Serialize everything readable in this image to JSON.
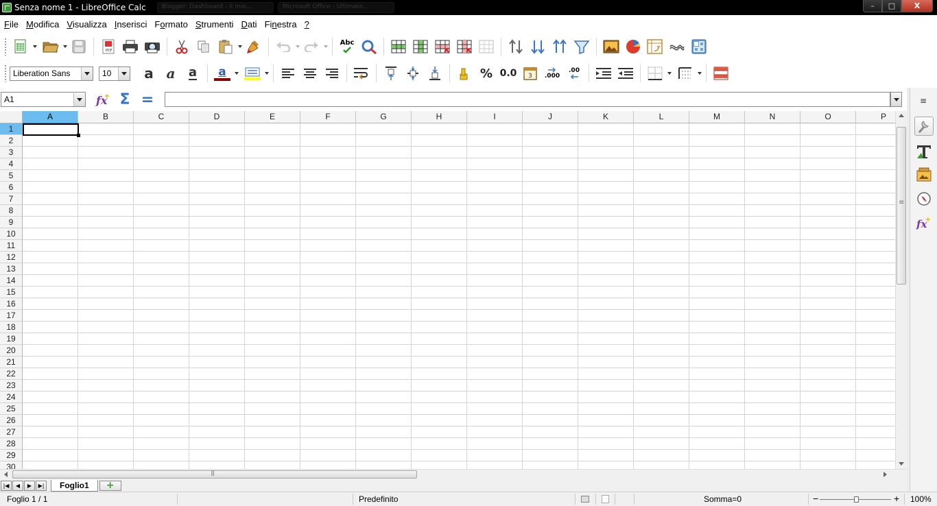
{
  "window": {
    "title": "Senza nome 1 - LibreOffice Calc",
    "background_tabs": [
      "Blogger: Dashboard - Il mio...",
      "Microsoft Office - Ultimate..."
    ],
    "controls": {
      "minimize": "–",
      "maximize": "□",
      "close": "X"
    }
  },
  "menubar": {
    "items": [
      {
        "pre": "",
        "u": "F",
        "post": "ile"
      },
      {
        "pre": "",
        "u": "M",
        "post": "odifica"
      },
      {
        "pre": "",
        "u": "V",
        "post": "isualizza"
      },
      {
        "pre": "",
        "u": "I",
        "post": "nserisci"
      },
      {
        "pre": "F",
        "u": "o",
        "post": "rmato"
      },
      {
        "pre": "",
        "u": "S",
        "post": "trumenti"
      },
      {
        "pre": "",
        "u": "D",
        "post": "ati"
      },
      {
        "pre": "Fi",
        "u": "n",
        "post": "estra"
      },
      {
        "pre": "",
        "u": "?",
        "post": ""
      }
    ]
  },
  "standard_toolbar": {
    "icons": [
      "new-document-icon",
      "open-folder-icon",
      "save-icon",
      "export-pdf-icon",
      "print-icon",
      "print-preview-icon",
      "cut-icon",
      "copy-icon",
      "paste-icon",
      "clone-formatting-icon",
      "undo-icon",
      "redo-icon",
      "spellcheck-icon",
      "autospellcheck-icon",
      "insert-rows-icon",
      "insert-columns-icon",
      "delete-rows-icon",
      "delete-columns-icon",
      "merge-cells-icon",
      "sort-icon",
      "sort-ascending-icon",
      "sort-descending-icon",
      "autofilter-icon",
      "insert-image-icon",
      "insert-chart-icon",
      "pivot-table-icon",
      "special-character-icon",
      "show-draw-functions-icon"
    ],
    "spellcheck_label": "Abc"
  },
  "formatting_toolbar": {
    "font_name": "Liberation Sans",
    "font_size": "10",
    "font_color": "#8b0000",
    "highlight_color": "#ffff00",
    "bold_glyph": "a",
    "italic_glyph": "a",
    "underline_glyph": "a",
    "font_color_glyph": "a",
    "percent_label": "%",
    "decimal_label": "0.0",
    "add_decimal_label": ".000",
    "del_decimal_label": ".00"
  },
  "formula_bar": {
    "name_box_value": "A1",
    "formula_value": "",
    "sum_glyph": "Σ",
    "equals_glyph": "="
  },
  "grid": {
    "columns": [
      "A",
      "B",
      "C",
      "D",
      "E",
      "F",
      "G",
      "H",
      "I",
      "J",
      "K",
      "L",
      "M",
      "N",
      "O",
      "P"
    ],
    "rows": [
      "1",
      "2",
      "3",
      "4",
      "5",
      "6",
      "7",
      "8",
      "9",
      "10",
      "11",
      "12",
      "13",
      "14",
      "15",
      "16",
      "17",
      "18",
      "19",
      "20",
      "21",
      "22",
      "23",
      "24",
      "25",
      "26",
      "27",
      "28",
      "29",
      "30"
    ],
    "active_cell": "A1",
    "active_color": "#6bbcef"
  },
  "sheet_tabs": {
    "tabs": [
      "Foglio1"
    ],
    "add_label": "+",
    "nav": [
      "|◀",
      "◀",
      "▶",
      "▶|"
    ]
  },
  "statusbar": {
    "sheet_info": "Foglio 1 / 1",
    "page_style": "Predefinito",
    "sum": "Somma=0",
    "zoom_minus": "−",
    "zoom_plus": "+",
    "zoom": "100%"
  },
  "sidebar": {
    "menu_glyph": "≡",
    "icons": [
      "properties-icon",
      "styles-icon",
      "gallery-icon",
      "navigator-icon",
      "functions-icon"
    ]
  }
}
